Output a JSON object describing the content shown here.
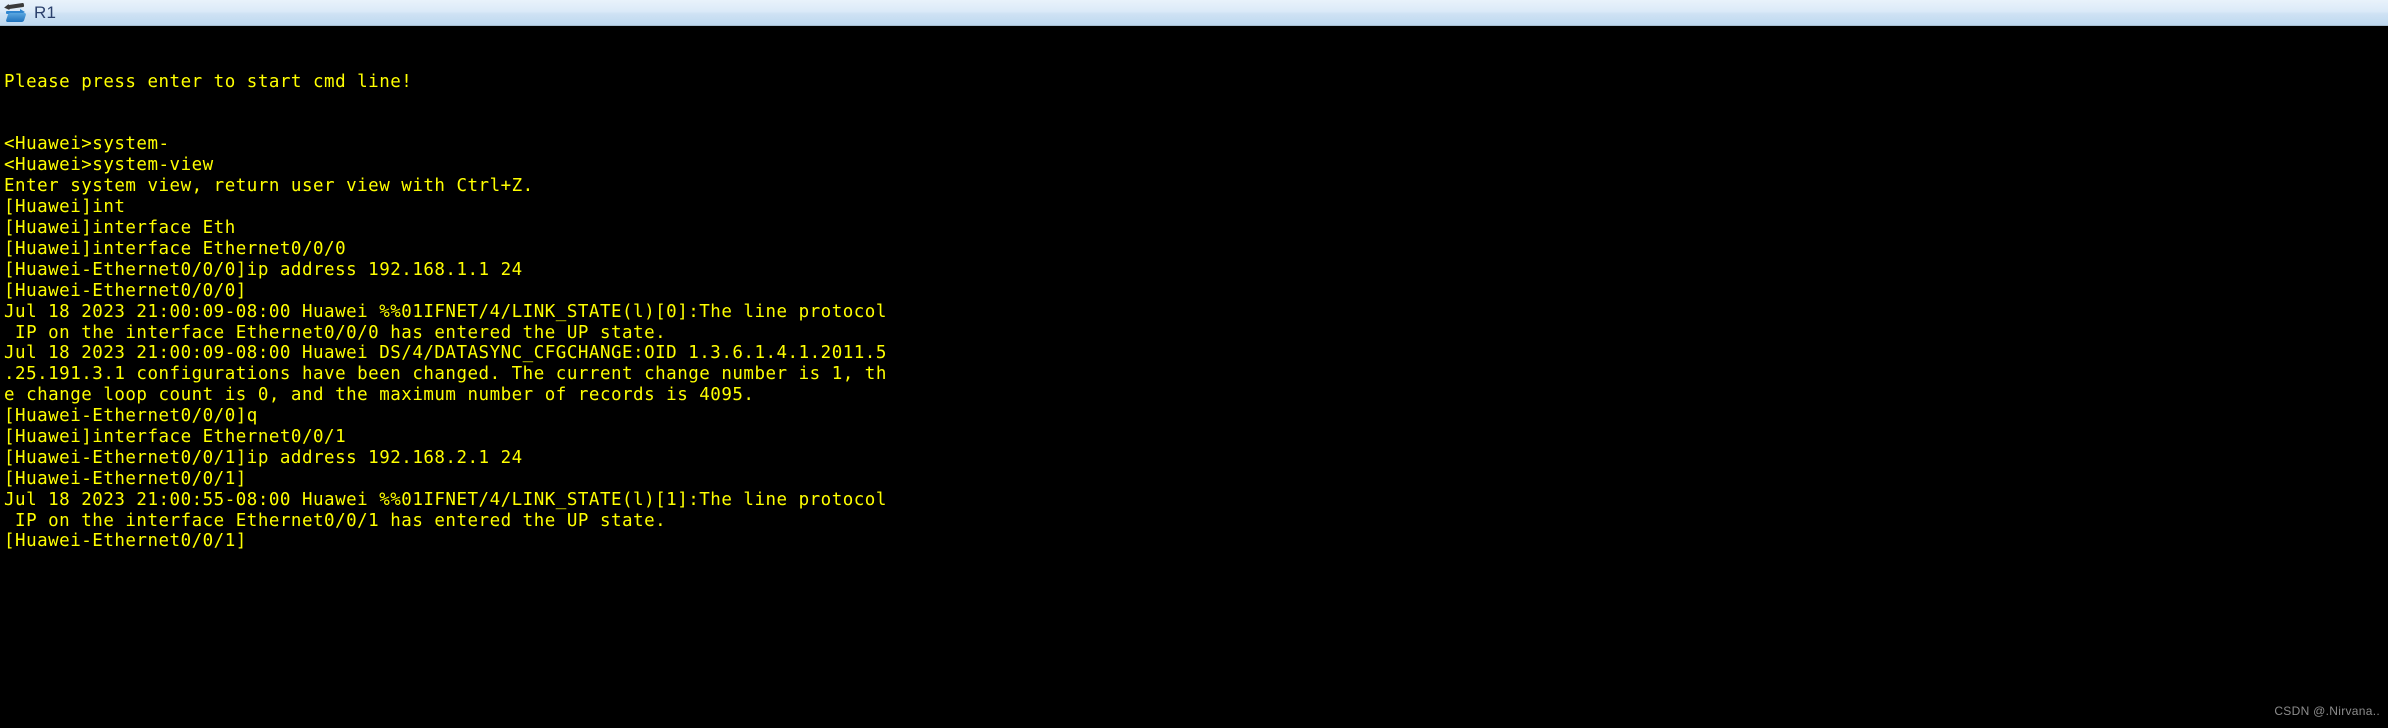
{
  "window": {
    "title": "R1",
    "icon": "router-icon"
  },
  "terminal": {
    "foreground_color": "#ffff00",
    "background_color": "#000000",
    "lines": [
      "Please press enter to start cmd line!",
      "",
      "",
      "<Huawei>system-",
      "<Huawei>system-view",
      "Enter system view, return user view with Ctrl+Z.",
      "[Huawei]int",
      "[Huawei]interface Eth",
      "[Huawei]interface Ethernet0/0/0",
      "[Huawei-Ethernet0/0/0]ip address 192.168.1.1 24",
      "[Huawei-Ethernet0/0/0]",
      "Jul 18 2023 21:00:09-08:00 Huawei %%01IFNET/4/LINK_STATE(l)[0]:The line protocol",
      " IP on the interface Ethernet0/0/0 has entered the UP state.",
      "Jul 18 2023 21:00:09-08:00 Huawei DS/4/DATASYNC_CFGCHANGE:OID 1.3.6.1.4.1.2011.5",
      ".25.191.3.1 configurations have been changed. The current change number is 1, th",
      "e change loop count is 0, and the maximum number of records is 4095.",
      "[Huawei-Ethernet0/0/0]q",
      "[Huawei]interface Ethernet0/0/1",
      "[Huawei-Ethernet0/0/1]ip address 192.168.2.1 24",
      "[Huawei-Ethernet0/0/1]",
      "Jul 18 2023 21:00:55-08:00 Huawei %%01IFNET/4/LINK_STATE(l)[1]:The line protocol",
      " IP on the interface Ethernet0/0/1 has entered the UP state.",
      "[Huawei-Ethernet0/0/1]"
    ]
  },
  "watermark": {
    "text": "CSDN @.Nirvana.."
  }
}
